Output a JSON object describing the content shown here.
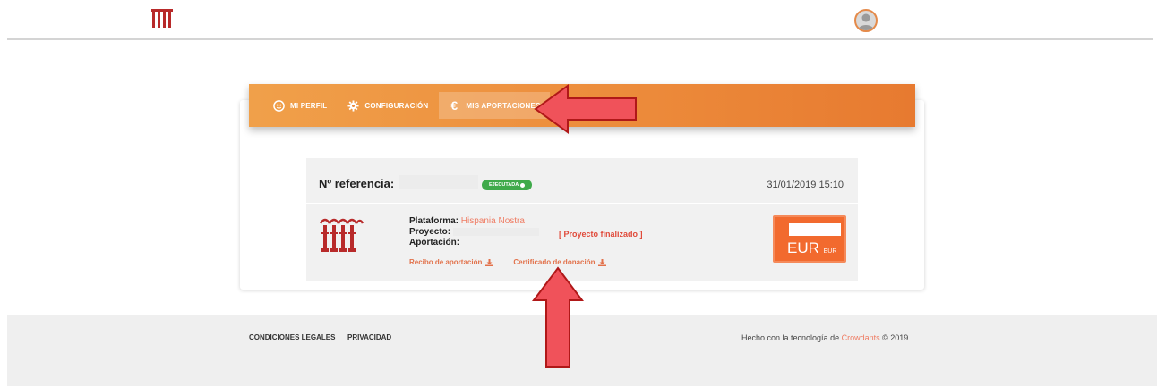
{
  "header": {
    "logo_icon": "aqueduct-logo-icon",
    "avatar_icon": "user-avatar-icon"
  },
  "tabs": [
    {
      "label": "MI PERFIL",
      "icon": "face-icon"
    },
    {
      "label": "CONFIGURACIÓN",
      "icon": "gear-icon"
    },
    {
      "label": "MIS APORTACIONES",
      "icon": "euro-icon",
      "active": true
    }
  ],
  "contribution": {
    "ref_label": "Nº referencia:",
    "status": "EJECUTADA",
    "date": "31/01/2019 15:10",
    "platform_label": "Plataforma:",
    "platform_value": "Hispania Nostra",
    "project_label": "Proyecto:",
    "project_status": "[ Proyecto finalizado ]",
    "contribution_label": "Aportación:",
    "receipt_link": "Recibo de aportación",
    "certificate_link": "Certificado de donación",
    "currency": "EUR",
    "currency_small": "EUR"
  },
  "footer": {
    "legal": "CONDICIONES LEGALES",
    "privacy": "PRIVACIDAD",
    "credits_prefix": "Hecho con la tecnología de",
    "credits_brand": "Crowdants",
    "credits_suffix": "© 2019"
  },
  "colors": {
    "accent": "#ec8a3a",
    "link": "#e2714a",
    "status_green": "#3faa4a",
    "annotation_red": "#f0525a"
  }
}
